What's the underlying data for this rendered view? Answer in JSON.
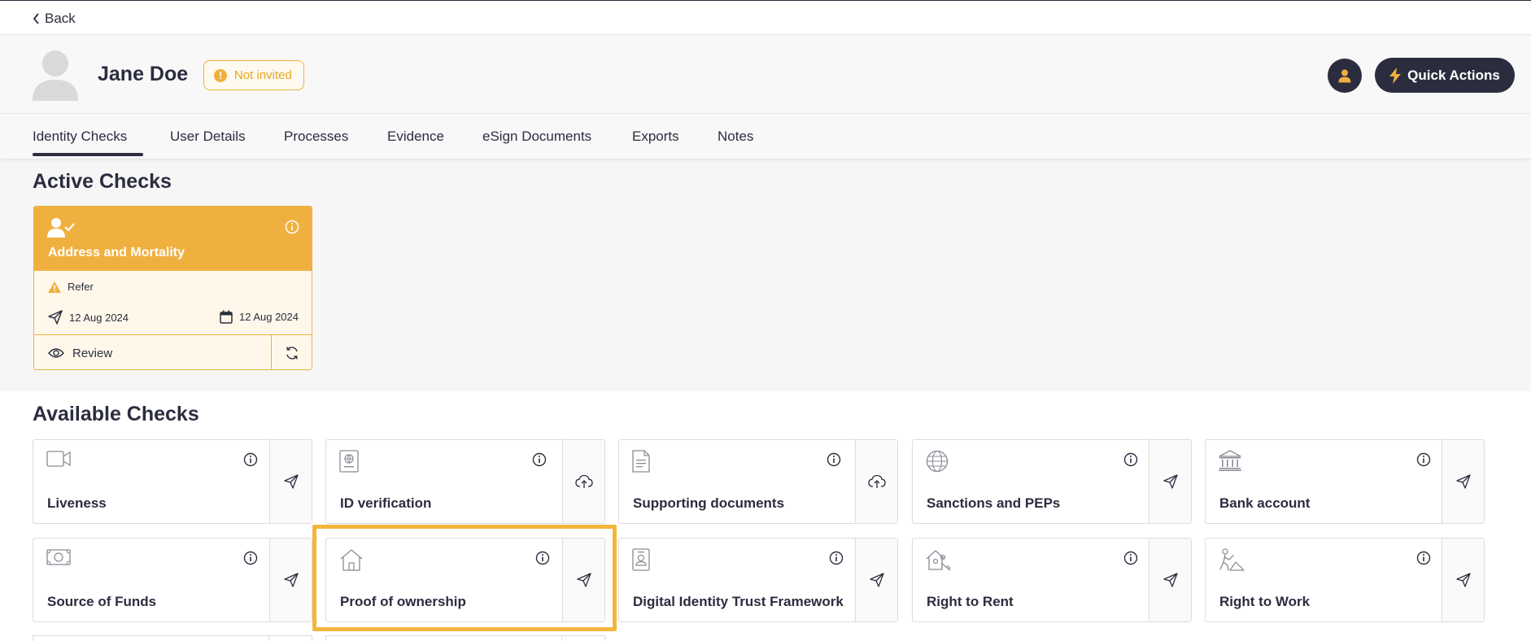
{
  "nav": {
    "back_label": "Back"
  },
  "profile": {
    "name": "Jane Doe",
    "status": "Not invited",
    "status_color": "#f0b040"
  },
  "header": {
    "quick_actions_label": "Quick Actions"
  },
  "tabs": [
    {
      "label": "Identity Checks",
      "active": true
    },
    {
      "label": "User Details"
    },
    {
      "label": "Processes"
    },
    {
      "label": "Evidence"
    },
    {
      "label": "eSign Documents"
    },
    {
      "label": "Exports"
    },
    {
      "label": "Notes"
    }
  ],
  "active_checks": {
    "title": "Active Checks",
    "items": [
      {
        "title": "Address and Mortality",
        "status": "Refer",
        "sent_date": "12 Aug 2024",
        "due_date": "12 Aug 2024",
        "review_label": "Review",
        "icon": "user-check-icon"
      }
    ]
  },
  "available_checks": {
    "title": "Available Checks",
    "items": [
      {
        "label": "Liveness",
        "icon": "video-icon",
        "action": "send-icon"
      },
      {
        "label": "ID verification",
        "icon": "passport-icon",
        "action": "upload-icon"
      },
      {
        "label": "Supporting documents",
        "icon": "document-icon",
        "action": "upload-icon"
      },
      {
        "label": "Sanctions and PEPs",
        "icon": "globe-icon",
        "action": "send-icon"
      },
      {
        "label": "Bank account",
        "icon": "bank-icon",
        "action": "send-icon"
      },
      {
        "label": "Source of Funds",
        "icon": "banknote-icon",
        "action": "send-icon"
      },
      {
        "label": "Proof of ownership",
        "icon": "home-icon",
        "action": "send-icon",
        "highlighted": true
      },
      {
        "label": "Digital Identity Trust Framework",
        "icon": "id-card-icon",
        "action": "send-icon"
      },
      {
        "label": "Right to Rent",
        "icon": "house-key-icon",
        "action": "send-icon"
      },
      {
        "label": "Right to Work",
        "icon": "worker-icon",
        "action": "send-icon"
      }
    ]
  },
  "colors": {
    "primary_dark": "#2b2d3f",
    "accent_amber": "#f0b040",
    "highlight_border": "#f3b63c"
  }
}
